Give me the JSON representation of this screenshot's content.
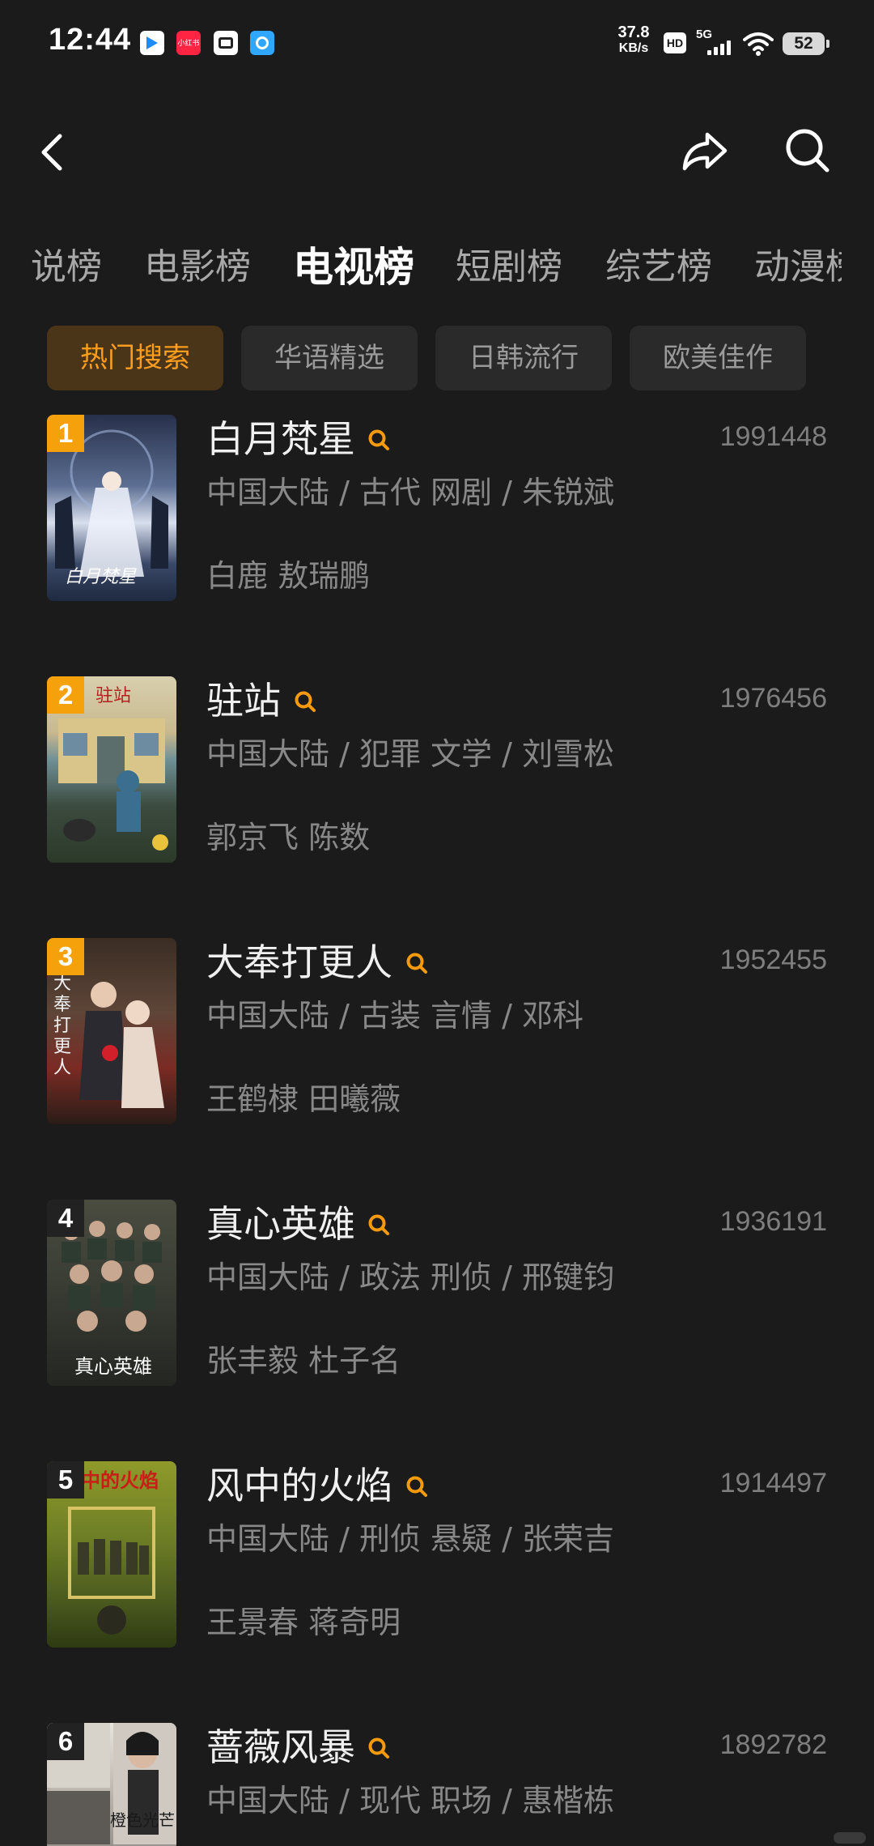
{
  "status_bar": {
    "time": "12:44",
    "net_speed_value": "37.8",
    "net_speed_unit": "KB/s",
    "hd_label": "HD",
    "network_label": "5G",
    "battery_level": "52",
    "notification_icons": [
      "video-app-icon",
      "xiaohongshu-icon",
      "wallet-icon",
      "browser-icon"
    ],
    "notif_2_text": "小红书"
  },
  "nav": {
    "back_icon": "chevron-left-icon",
    "share_icon": "share-icon",
    "search_icon": "search-icon"
  },
  "rank_tabs": [
    {
      "label": "说榜"
    },
    {
      "label": "电影榜"
    },
    {
      "label": "电视榜",
      "active": true
    },
    {
      "label": "短剧榜"
    },
    {
      "label": "综艺榜"
    },
    {
      "label": "动漫榜"
    }
  ],
  "filter_chips": [
    {
      "label": "热门搜索",
      "active": true
    },
    {
      "label": "华语精选"
    },
    {
      "label": "日韩流行"
    },
    {
      "label": "欧美佳作"
    }
  ],
  "colors": {
    "background": "#1b1b1b",
    "accent": "#ff9d1f",
    "rank_badge_top": "#f5a10c",
    "rank_badge_other": "#222222"
  },
  "items": [
    {
      "rank": "1",
      "title": "白月梵星",
      "hot": "1991448",
      "meta": "中国大陆 / 古代 网剧 / 朱锐斌",
      "cast": "白鹿 敖瑞鹏",
      "poster_text": "白月梵星"
    },
    {
      "rank": "2",
      "title": "驻站",
      "hot": "1976456",
      "meta": "中国大陆 / 犯罪 文学 / 刘雪松",
      "cast": "郭京飞 陈数",
      "poster_text": "驻站"
    },
    {
      "rank": "3",
      "title": "大奉打更人",
      "hot": "1952455",
      "meta": "中国大陆 / 古装 言情 / 邓科",
      "cast": "王鹤棣 田曦薇",
      "poster_text": "大奉打更人"
    },
    {
      "rank": "4",
      "title": "真心英雄",
      "hot": "1936191",
      "meta": "中国大陆 / 政法 刑侦 / 邢键钧",
      "cast": "张丰毅 杜子名",
      "poster_text": "真心英雄"
    },
    {
      "rank": "5",
      "title": "风中的火焰",
      "hot": "1914497",
      "meta": "中国大陆 / 刑侦 悬疑 / 张荣吉",
      "cast": "王景春 蒋奇明",
      "poster_text": "风中的火焰"
    },
    {
      "rank": "6",
      "title": "蔷薇风暴",
      "hot": "1892782",
      "meta": "中国大陆 / 现代 职场 / 惠楷栋",
      "cast": "",
      "poster_text": "橙色光芒"
    }
  ]
}
